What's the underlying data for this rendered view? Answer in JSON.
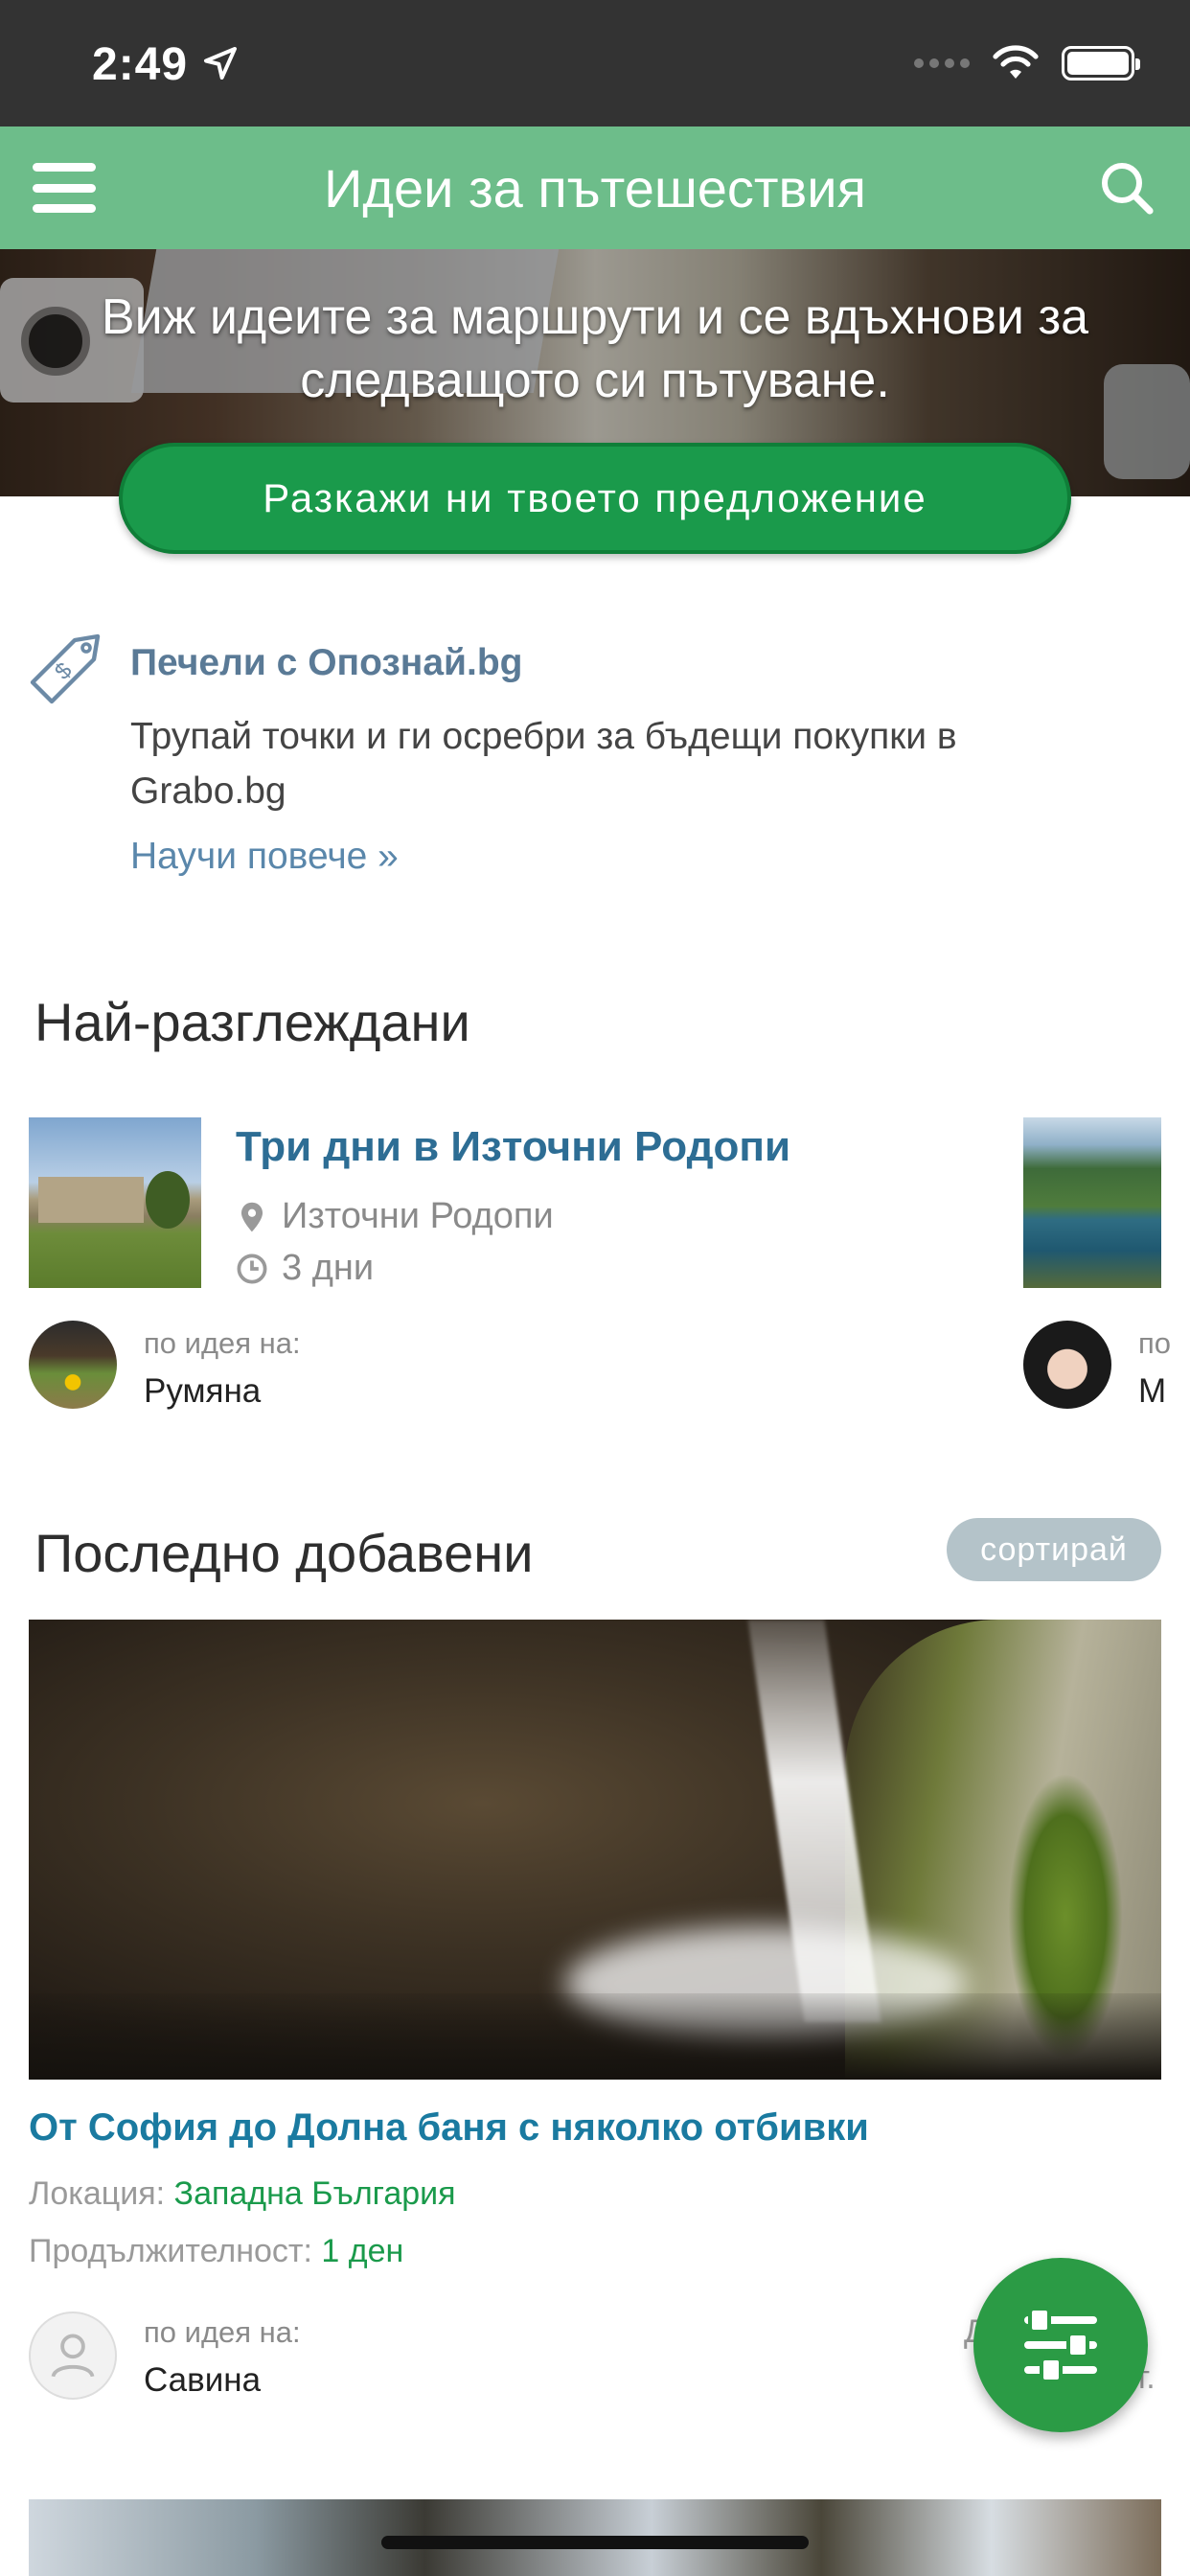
{
  "status_bar": {
    "time": "2:49"
  },
  "nav": {
    "title": "Идеи за пътешествия"
  },
  "hero": {
    "text": "Виж идеите за маршрути и се вдъхнови за следващото си пътуване.",
    "cta_label": "Разкажи ни твоето предложение"
  },
  "promo": {
    "title": "Печели с Опознай.bg",
    "description": "Трупай точки и ги осребри за бъдещи покупки в Grabo.bg",
    "link": "Научи повече »"
  },
  "most_viewed": {
    "title": "Най-разглеждани",
    "items": [
      {
        "title": "Три дни в Източни Родопи",
        "location": "Източни Родопи",
        "duration": "3 дни",
        "author_label": "по идея на:",
        "author_name": "Румяна"
      },
      {
        "author_label_partial": "по",
        "author_name_partial": "М"
      }
    ]
  },
  "latest": {
    "title": "Последно добавени",
    "sort_label": "сортирай",
    "items": [
      {
        "title": "От София до Долна баня с няколко отбивки",
        "location_label": "Локация:",
        "location": "Западна България",
        "duration_label": "Продължителност:",
        "duration": "1 ден",
        "author_label": "по идея на:",
        "author_name": "Савина",
        "peek_right_top": "Д",
        "peek_right_bottom": "г."
      }
    ]
  },
  "icons": {
    "menu": "hamburger-icon",
    "search": "search-icon",
    "promo": "money-tag-icon",
    "location": "location-pin-icon",
    "duration": "clock-icon",
    "fab": "filter-sliders-icon"
  },
  "colors": {
    "nav_bg": "#6dbd8a",
    "cta_bg": "#1a9a4b",
    "link_blue": "#2d6d94",
    "accent_green": "#1a9a4b",
    "sort_bg": "#b4c3c9",
    "fab_bg": "#2b9b45"
  }
}
